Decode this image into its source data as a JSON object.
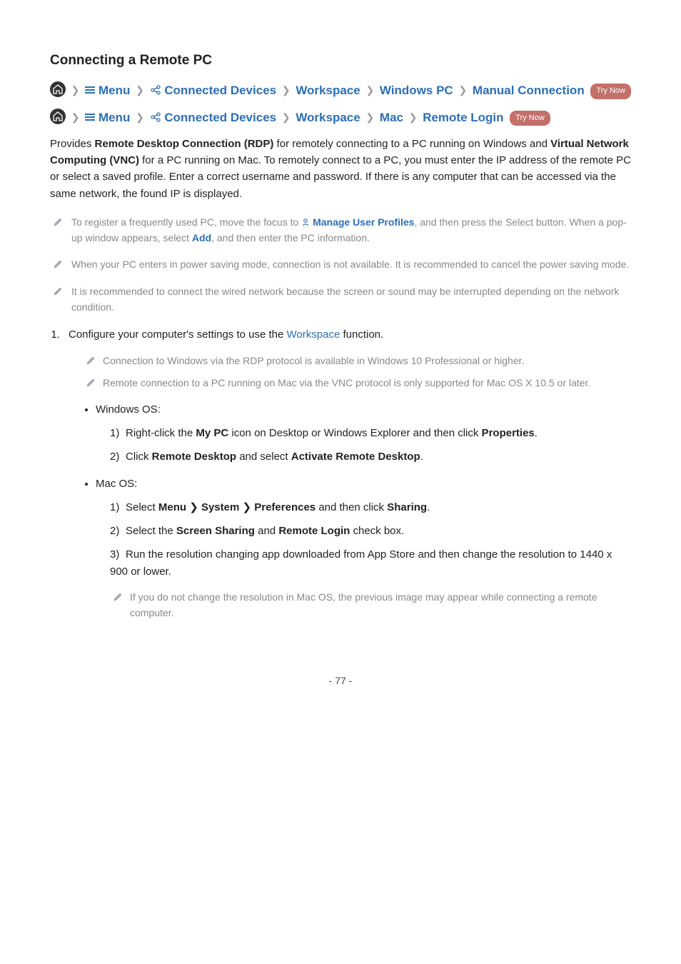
{
  "title": "Connecting a Remote PC",
  "nav1": {
    "menu": "Menu",
    "devices": "Connected Devices",
    "workspace": "Workspace",
    "os": "Windows PC",
    "action": "Manual Connection",
    "try": "Try Now"
  },
  "nav2": {
    "menu": "Menu",
    "devices": "Connected Devices",
    "workspace": "Workspace",
    "os": "Mac",
    "action": "Remote Login",
    "try": "Try Now"
  },
  "intro": {
    "t1": "Provides ",
    "b1": "Remote Desktop Connection (RDP)",
    "t2": " for remotely connecting to a PC running on Windows and ",
    "b2": "Virtual Network Computing (VNC)",
    "t3": " for a PC running on Mac. To remotely connect to a PC, you must enter the IP address of the remote PC or select a saved profile. Enter a correct username and password. If there is any computer that can be accessed via the same network, the found IP is displayed."
  },
  "notes": {
    "n1a": "To register a frequently used PC, move the focus to ",
    "n1link": "Manage User Profiles",
    "n1b": ", and then press the Select button. When a pop-up window appears, select ",
    "n1add": "Add",
    "n1c": ", and then enter the PC information.",
    "n2": "When your PC enters in power saving mode, connection is not available. It is recommended to cancel the power saving mode.",
    "n3": "It is recommended to connect the wired network because the screen or sound may be interrupted depending on the network condition."
  },
  "step1": {
    "pre": "Configure your computer's settings to use the ",
    "ws": "Workspace",
    "post": " function.",
    "sub1": "Connection to Windows via the RDP protocol is available in Windows 10 Professional or higher.",
    "sub2": "Remote connection to a PC running on Mac via the VNC protocol is only supported for Mac OS X 10.5 or later."
  },
  "win": {
    "label": "Windows OS:",
    "s1a": "Right-click the ",
    "s1b": "My PC",
    "s1c": " icon on Desktop or Windows Explorer and then click ",
    "s1d": "Properties",
    "s1e": ".",
    "s2a": "Click ",
    "s2b": "Remote Desktop",
    "s2c": " and select ",
    "s2d": "Activate Remote Desktop",
    "s2e": "."
  },
  "mac": {
    "label": "Mac OS:",
    "s1a": "Select ",
    "s1b": "Menu",
    "s1c": "System",
    "s1d": "Preferences",
    "s1e": " and then click ",
    "s1f": "Sharing",
    "s1g": ".",
    "s2a": "Select the ",
    "s2b": "Screen Sharing",
    "s2c": " and ",
    "s2d": "Remote Login",
    "s2e": " check box.",
    "s3": "Run the resolution changing app downloaded from App Store and then change the resolution to 1440 x 900 or lower.",
    "note": "If you do not change the resolution in Mac OS, the previous image may appear while connecting a remote computer."
  },
  "pagenum": "- 77 -"
}
